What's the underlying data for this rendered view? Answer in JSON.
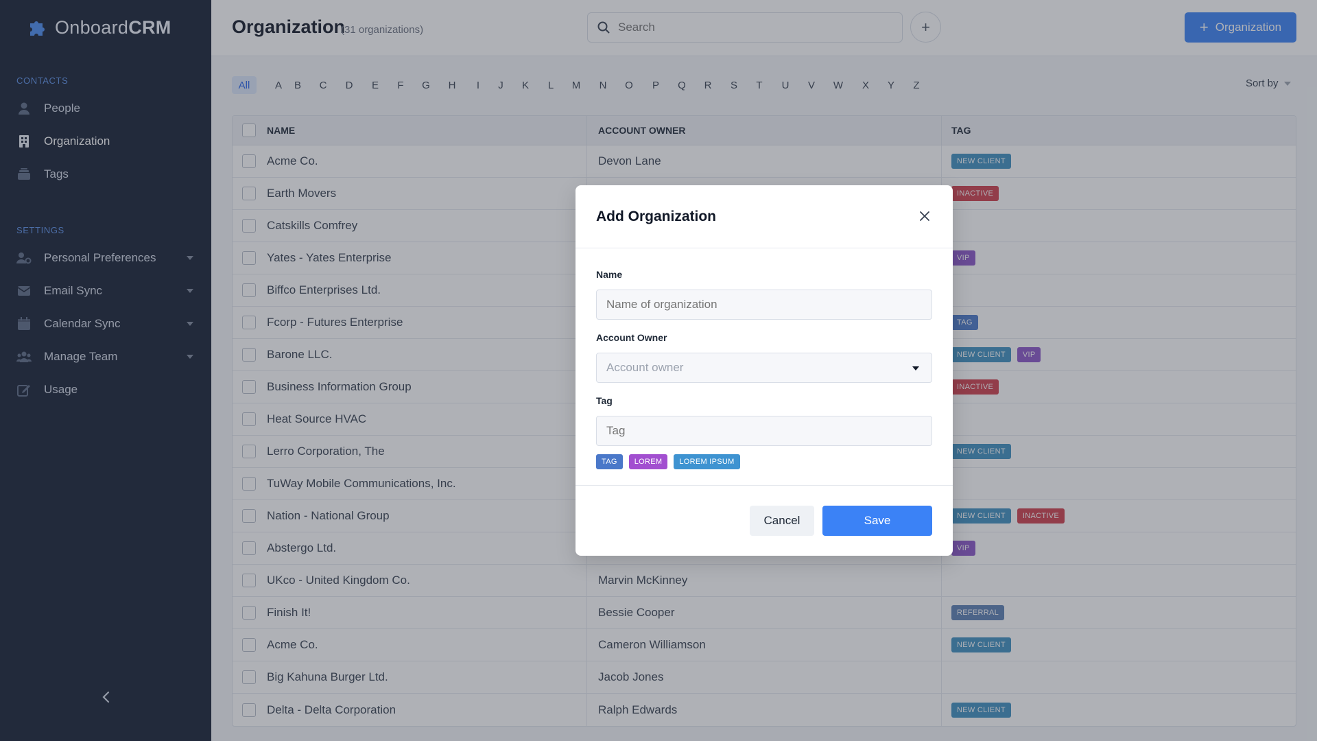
{
  "brand": {
    "name_light": "Onboard",
    "name_bold": "CRM"
  },
  "sidebar": {
    "contacts_label": "CONTACTS",
    "settings_label": "SETTINGS",
    "contacts": [
      {
        "label": "People",
        "icon": "person-icon"
      },
      {
        "label": "Organization",
        "icon": "building-icon",
        "active": true
      },
      {
        "label": "Tags",
        "icon": "tags-icon"
      }
    ],
    "settings": [
      {
        "label": "Personal Preferences",
        "icon": "user-settings-icon"
      },
      {
        "label": "Email Sync",
        "icon": "envelope-icon"
      },
      {
        "label": "Calendar Sync",
        "icon": "calendar-icon"
      },
      {
        "label": "Manage Team",
        "icon": "team-icon"
      },
      {
        "label": "Usage",
        "icon": "edit-icon"
      }
    ]
  },
  "header": {
    "title": "Organization",
    "subtitle": "(31 organizations)",
    "search_placeholder": "Search",
    "add_button_label": "Organization"
  },
  "alphabet": {
    "all_label": "All",
    "letters": [
      "A",
      "B",
      "C",
      "D",
      "E",
      "F",
      "G",
      "H",
      "I",
      "J",
      "K",
      "L",
      "M",
      "N",
      "O",
      "P",
      "Q",
      "R",
      "S",
      "T",
      "U",
      "V",
      "W",
      "X",
      "Y",
      "Z"
    ],
    "sort_label": "Sort by"
  },
  "table": {
    "columns": [
      "NAME",
      "ACCOUNT OWNER",
      "TAG"
    ],
    "rows": [
      {
        "name": "Acme Co.",
        "owner": "Devon Lane",
        "tags": [
          "NEW CLIENT"
        ]
      },
      {
        "name": "Earth Movers",
        "owner": "",
        "tags": [
          "INACTIVE"
        ]
      },
      {
        "name": "Catskills Comfrey",
        "owner": "",
        "tags": []
      },
      {
        "name": "Yates - Yates Enterprise",
        "owner": "",
        "tags": [
          "VIP"
        ]
      },
      {
        "name": "Biffco Enterprises Ltd.",
        "owner": "",
        "tags": []
      },
      {
        "name": "Fcorp - Futures Enterprise",
        "owner": "",
        "tags": [
          "TAG"
        ]
      },
      {
        "name": "Barone LLC.",
        "owner": "",
        "tags": [
          "NEW CLIENT",
          "VIP"
        ]
      },
      {
        "name": "Business Information Group",
        "owner": "",
        "tags": [
          "INACTIVE"
        ]
      },
      {
        "name": "Heat Source HVAC",
        "owner": "",
        "tags": []
      },
      {
        "name": "Lerro Corporation, The",
        "owner": "",
        "tags": [
          "NEW CLIENT"
        ]
      },
      {
        "name": "TuWay Mobile Communications, Inc.",
        "owner": "",
        "tags": []
      },
      {
        "name": "Nation - National Group",
        "owner": "",
        "tags": [
          "NEW CLIENT",
          "INACTIVE"
        ]
      },
      {
        "name": "Abstergo Ltd.",
        "owner": "",
        "tags": [
          "VIP"
        ]
      },
      {
        "name": "UKco - United Kingdom Co.",
        "owner": "Marvin McKinney",
        "tags": []
      },
      {
        "name": "Finish It!",
        "owner": "Bessie Cooper",
        "tags": [
          "REFERRAL"
        ]
      },
      {
        "name": "Acme Co.",
        "owner": "Cameron Williamson",
        "tags": [
          "NEW CLIENT"
        ]
      },
      {
        "name": "Big Kahuna Burger Ltd.",
        "owner": "Jacob Jones",
        "tags": []
      },
      {
        "name": "Delta - Delta Corporation",
        "owner": "Ralph Edwards",
        "tags": [
          "NEW CLIENT"
        ]
      }
    ]
  },
  "tag_colors": {
    "NEW CLIENT": "#3f8fc0",
    "INACTIVE": "#cf3f4c",
    "VIP": "#8b55c9",
    "TAG": "#4a78c9",
    "REFERRAL": "#5b7fb3",
    "LOREM": "#a24fd0",
    "LOREM IPSUM": "#3e93d1"
  },
  "modal": {
    "title": "Add Organization",
    "name_label": "Name",
    "name_placeholder": "Name of organization",
    "owner_label": "Account Owner",
    "owner_placeholder": "Account owner",
    "tag_label": "Tag",
    "tag_placeholder": "Tag",
    "tag_options": [
      "TAG",
      "LOREM",
      "LOREM IPSUM"
    ],
    "cancel_label": "Cancel",
    "save_label": "Save"
  },
  "colors": {
    "sidebar_bg": "#141e33",
    "accent": "#3b82f6"
  }
}
